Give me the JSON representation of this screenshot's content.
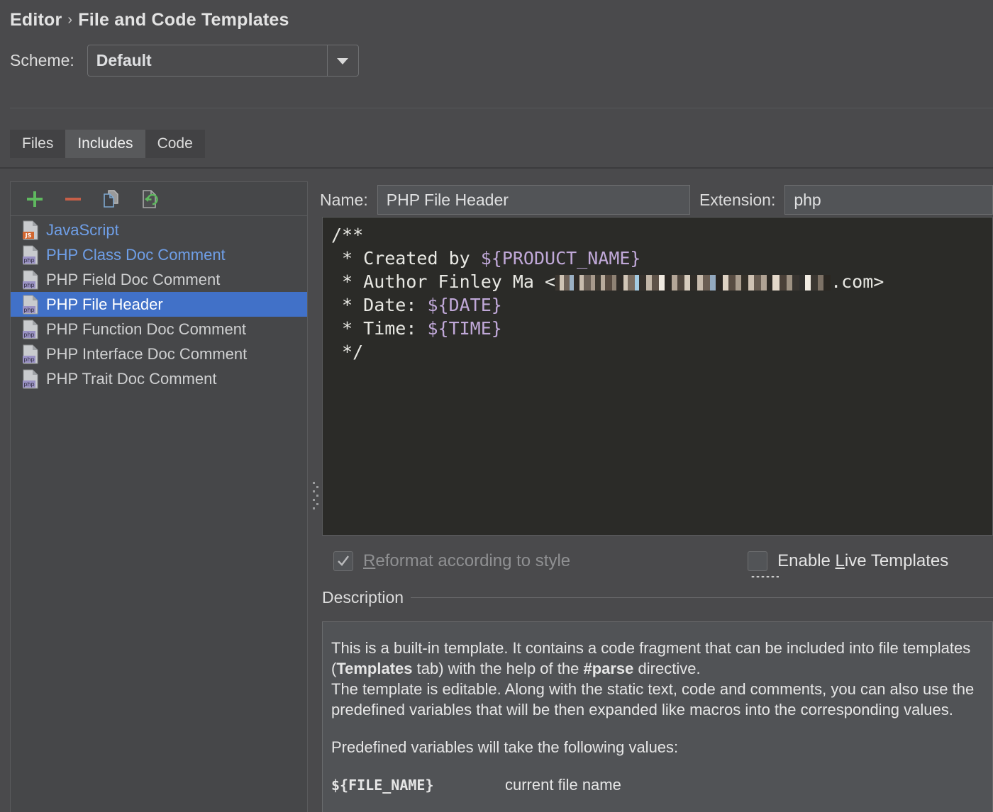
{
  "header": {
    "breadcrumb_root": "Editor",
    "breadcrumb_sep": "›",
    "breadcrumb_current": "File and Code Templates",
    "scheme_label": "Scheme:",
    "scheme_value": "Default"
  },
  "tabs": [
    {
      "label": "Files",
      "selected": false
    },
    {
      "label": "Includes",
      "selected": true
    },
    {
      "label": "Code",
      "selected": false
    }
  ],
  "list_toolbar": [
    {
      "name": "add-icon",
      "tooltip": "Add"
    },
    {
      "name": "remove-icon",
      "tooltip": "Remove"
    },
    {
      "name": "copy-icon",
      "tooltip": "Copy"
    },
    {
      "name": "reset-icon",
      "tooltip": "Reset To Default"
    }
  ],
  "templates": [
    {
      "label": "JavaScript",
      "icon": "js-file-icon",
      "custom": true,
      "selected": false
    },
    {
      "label": "PHP Class Doc Comment",
      "icon": "php-file-icon",
      "custom": true,
      "selected": false
    },
    {
      "label": "PHP Field Doc Comment",
      "icon": "php-file-icon",
      "custom": false,
      "selected": false
    },
    {
      "label": "PHP File Header",
      "icon": "php-file-icon",
      "custom": false,
      "selected": true
    },
    {
      "label": "PHP Function Doc Comment",
      "icon": "php-file-icon",
      "custom": false,
      "selected": false
    },
    {
      "label": "PHP Interface Doc Comment",
      "icon": "php-file-icon",
      "custom": false,
      "selected": false
    },
    {
      "label": "PHP Trait Doc Comment",
      "icon": "php-file-icon",
      "custom": false,
      "selected": false
    }
  ],
  "detail": {
    "name_label": "Name:",
    "name_value": "PHP File Header",
    "extension_label": "Extension:",
    "extension_value": "php",
    "code": {
      "line1": "/**",
      "line2_static": " * Created by ",
      "line2_var": "${PRODUCT_NAME}",
      "line3_prefix": " * Author Finley Ma <",
      "line3_redacted": "[redacted email]",
      "line3_suffix": ".com>",
      "line4_static": " * Date: ",
      "line4_var": "${DATE}",
      "line5_static": " * Time: ",
      "line5_var": "${TIME}",
      "line6": " */"
    },
    "options": [
      {
        "label_pre": "",
        "mnemonic": "R",
        "label_post": "eformat according to style",
        "checked": true,
        "disabled": true,
        "focused": false
      },
      {
        "label_pre": "Enable ",
        "mnemonic": "L",
        "label_post": "ive Templates",
        "checked": false,
        "disabled": false,
        "focused": true
      }
    ],
    "description_title": "Description",
    "description": {
      "p1_a": "This is a built-in template. It contains a code fragment that can be included into file templates (",
      "p1_b": "Templates",
      "p1_c": " tab) with the help of the ",
      "p1_d": "#parse",
      "p1_e": " directive.",
      "p2": "The template is editable. Along with the static text, code and comments, you can also use the predefined variables that will be then expanded like macros into the corresponding values.",
      "p3": "Predefined variables will take the following values:",
      "var_name": "${FILE_NAME}",
      "var_desc": "current file name"
    }
  },
  "colors": {
    "selection_blue": "#4171c8",
    "custom_item_blue": "#6f9fe8",
    "editor_bg": "#2b2b28",
    "template_var": "#c0a8d8",
    "add_green": "#5fb85f",
    "remove_red": "#c75f48",
    "panel_bg": "#464749",
    "window_bg": "#4a4a4c"
  }
}
